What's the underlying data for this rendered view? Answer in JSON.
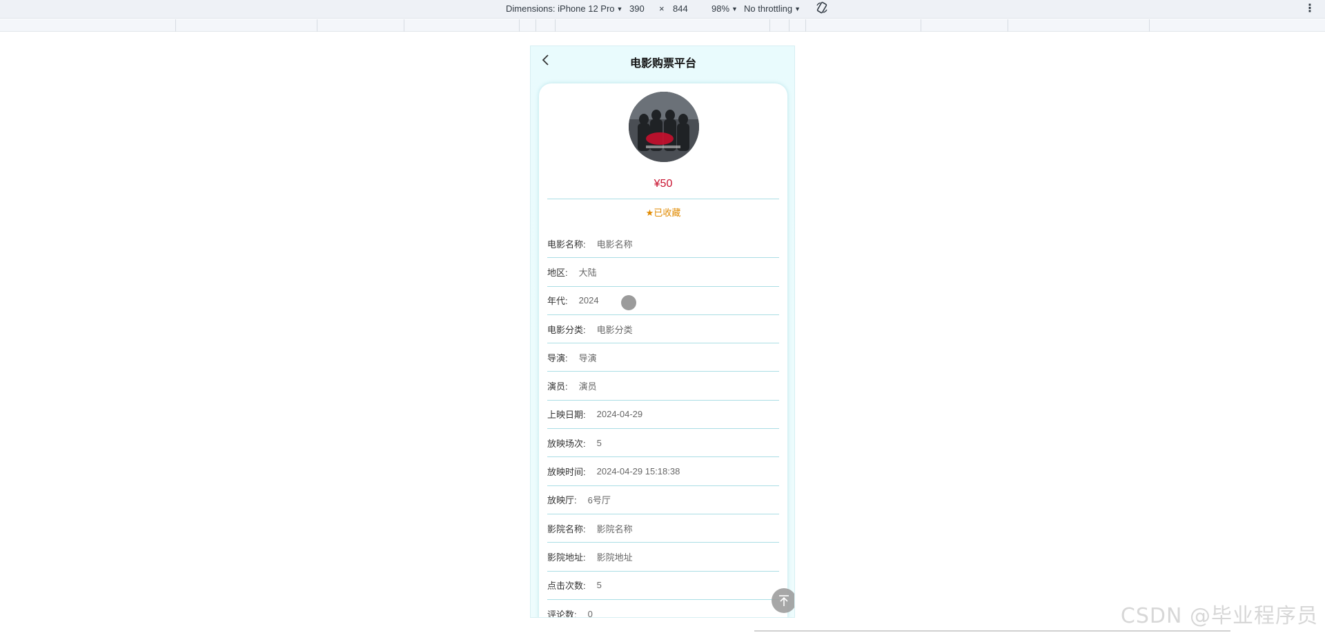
{
  "devtools": {
    "dimensions_label": "Dimensions: iPhone 12 Pro",
    "width": "390",
    "times": "×",
    "height": "844",
    "zoom": "98%",
    "throttling": "No throttling",
    "rotate_icon": "rotate-icon",
    "more_icon": "more-vertical-icon"
  },
  "nav": {
    "back_icon": "chevron-left-icon",
    "title": "电影购票平台"
  },
  "detail": {
    "poster_icon": "movie-poster-image",
    "price": "¥50",
    "favorite_icon": "star-icon",
    "favorite_label": "已收藏",
    "fields": [
      {
        "label": "电影名称:",
        "value": "电影名称"
      },
      {
        "label": "地区:",
        "value": "大陆"
      },
      {
        "label": "年代:",
        "value": "2024"
      },
      {
        "label": "电影分类:",
        "value": "电影分类"
      },
      {
        "label": "导演:",
        "value": "导演"
      },
      {
        "label": "演员:",
        "value": "演员"
      },
      {
        "label": "上映日期:",
        "value": "2024-04-29"
      },
      {
        "label": "放映场次:",
        "value": "5"
      },
      {
        "label": "放映时间:",
        "value": "2024-04-29 15:18:38"
      },
      {
        "label": "放映厅:",
        "value": "6号厅"
      },
      {
        "label": "影院名称:",
        "value": "影院名称"
      },
      {
        "label": "影院地址:",
        "value": "影院地址"
      },
      {
        "label": "点击次数:",
        "value": "5"
      },
      {
        "label": "评论数:",
        "value": "0"
      }
    ],
    "back_to_top_icon": "arrow-up-to-top-icon"
  },
  "watermark": "CSDN @毕业程序员",
  "colors": {
    "accent": "#a9dde4",
    "price": "#c8102e",
    "favorite": "#e08a00"
  }
}
